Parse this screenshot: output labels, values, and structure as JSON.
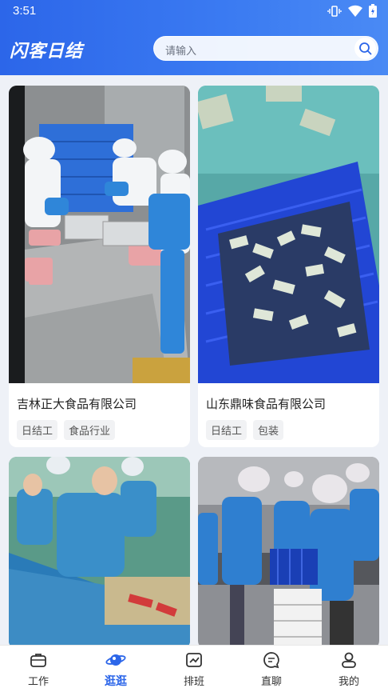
{
  "status": {
    "time": "3:51"
  },
  "app": {
    "logo": "闪客日结"
  },
  "search": {
    "placeholder": "请输入"
  },
  "cards": [
    {
      "title": "吉林正大食品有限公司",
      "tags": [
        "日结工",
        "食品行业"
      ]
    },
    {
      "title": "山东鼎味食品有限公司",
      "tags": [
        "日结工",
        "包装"
      ]
    }
  ],
  "nav": [
    {
      "label": "工作",
      "icon": "briefcase-icon"
    },
    {
      "label": "逛逛",
      "icon": "planet-icon"
    },
    {
      "label": "排班",
      "icon": "schedule-icon"
    },
    {
      "label": "直聊",
      "icon": "chat-icon"
    },
    {
      "label": "我的",
      "icon": "profile-icon"
    }
  ],
  "colors": {
    "primary": "#2c66e9",
    "background": "#eef1f7"
  }
}
